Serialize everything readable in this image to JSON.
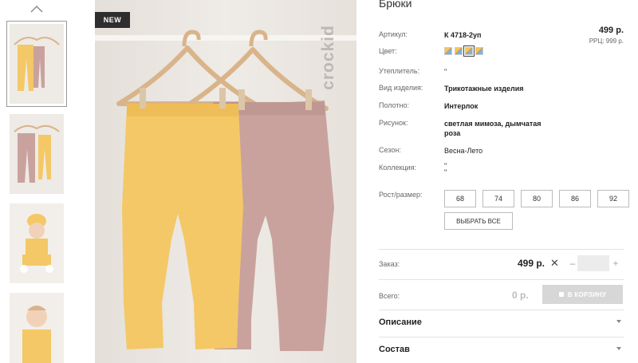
{
  "badge": "NEW",
  "brand": "crockid",
  "product": {
    "title": "Брюки",
    "price": "499 р.",
    "rrc": "РРЦ: 999 р."
  },
  "specs": {
    "article_label": "Артикул:",
    "article_value": "К 4718-2уп",
    "color_label": "Цвет:",
    "insulation_label": "Утеплитель:",
    "insulation_value": "\"",
    "type_label": "Вид изделия:",
    "type_value": "Трикотажные изделия",
    "fabric_label": "Полотно:",
    "fabric_value": "Интерлок",
    "pattern_label": "Рисунок:",
    "pattern_line1": "светлая мимоза, дымчатая",
    "pattern_line2": "роза",
    "season_label": "Сезон:",
    "season_value": "Весна-Лето",
    "collection_label": "Коллекция:",
    "collection_line1": "\"",
    "collection_line2": "\""
  },
  "sizes": {
    "label": "Рост/размер:",
    "options": [
      "68",
      "74",
      "80",
      "86",
      "92"
    ],
    "select_all": "ВЫБРАТЬ ВСЕ"
  },
  "order": {
    "label": "Заказ:",
    "price": "499 р.",
    "times": "✕",
    "minus": "–",
    "plus": "+",
    "quantity": ""
  },
  "total": {
    "label": "Всего:",
    "value": "0 р.",
    "cart_button": "В КОРЗИНУ"
  },
  "accordion": {
    "description": "Описание",
    "composition": "Состав"
  },
  "colors": {
    "pants_yellow": "#f4c866",
    "pants_pink": "#c9a29e",
    "hanger_wood": "#d9b48a",
    "badge_bg": "#2e2e2e",
    "cart_bg": "#d7d7d7"
  }
}
